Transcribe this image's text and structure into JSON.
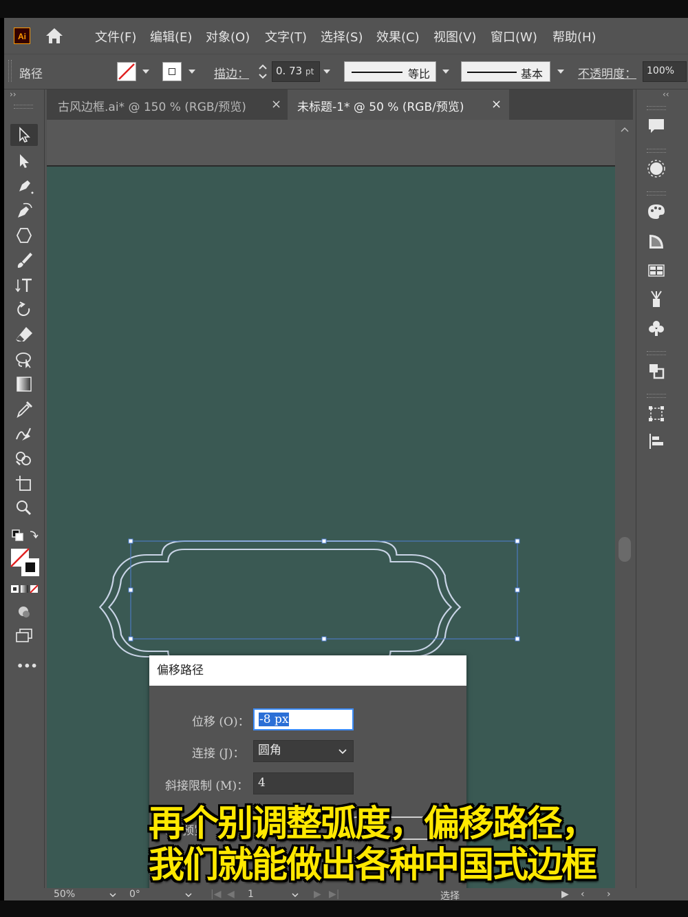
{
  "app": {
    "logo_text": "Ai"
  },
  "menu": [
    {
      "label": "文件(F)"
    },
    {
      "label": "编辑(E)"
    },
    {
      "label": "对象(O)"
    },
    {
      "label": "文字(T)"
    },
    {
      "label": "选择(S)"
    },
    {
      "label": "效果(C)"
    },
    {
      "label": "视图(V)"
    },
    {
      "label": "窗口(W)"
    },
    {
      "label": "帮助(H)"
    }
  ],
  "controlbar": {
    "selection_label": "路径",
    "stroke_label": "描边：",
    "stroke_value": "0. 73",
    "stroke_unit": "pt",
    "profile_label": "等比",
    "brush_label": "基本",
    "opacity_label": "不透明度：",
    "opacity_value": "100%"
  },
  "tabs": [
    {
      "label": "古风边框.ai* @ 150 % (RGB/预览)",
      "close": "×",
      "active": false
    },
    {
      "label": "未标题-1* @ 50 % (RGB/预览)",
      "close": "×",
      "active": true
    }
  ],
  "panel_collapse": {
    "left": "››",
    "right": "‹‹"
  },
  "toolbar": {
    "icons": [
      "selection-tool-icon",
      "direct-selection-tool-icon",
      "pen-tool-icon",
      "curvature-tool-icon",
      "shape-tool-icon",
      "paintbrush-tool-icon",
      "type-tool-icon",
      "rotate-tool-icon",
      "eraser-tool-icon",
      "lasso-tool-icon",
      "gradient-tool-icon",
      "eyedropper-tool-icon",
      "blend-tool-icon",
      "shape-builder-tool-icon",
      "artboard-tool-icon",
      "zoom-tool-icon"
    ],
    "more": "•••"
  },
  "right_panel": {
    "icons": [
      "comments-icon",
      "color-wheel-icon",
      "color-palette-icon",
      "gradient-panel-icon",
      "swatches-icon",
      "brushes-icon",
      "symbols-icon",
      "layers-icon",
      "transform-icon",
      "align-icon"
    ]
  },
  "dialog": {
    "title": "偏移路径",
    "offset_label": "位移 (O)：",
    "offset_value": "-8 px",
    "join_label": "连接 (J)：",
    "join_value": "圆角",
    "miter_label": "斜接限制 (M)：",
    "miter_value": "4",
    "preview_label": "预览"
  },
  "statusbar": {
    "zoom": "50%",
    "rotation": "0°",
    "artboard": "1",
    "tool": "选择"
  },
  "subtitles": {
    "line1": "再个别调整弧度，偏移路径，",
    "line2": "我们就能做出各种中国式边框"
  },
  "colors": {
    "canvas": "#3a5953",
    "frame_stroke": "#c9d4e6",
    "selection": "#4d7fd4",
    "subtitle": "#ffe800"
  }
}
